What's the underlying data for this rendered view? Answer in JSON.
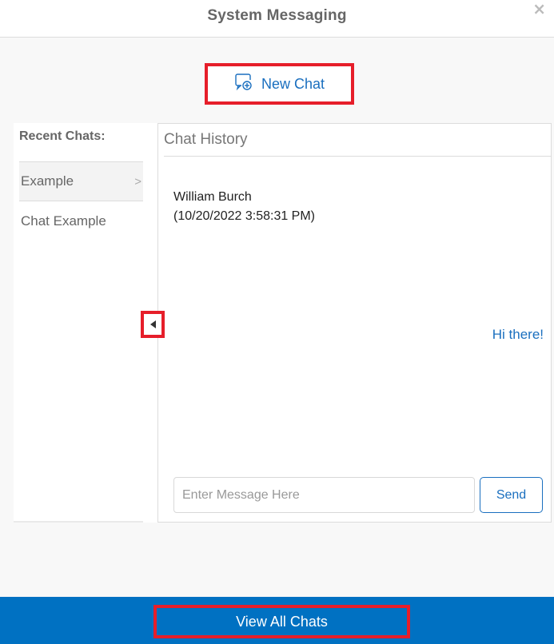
{
  "header": {
    "title": "System Messaging",
    "close_icon": "×"
  },
  "new_chat": {
    "label": "New Chat",
    "icon": "chat-add-icon"
  },
  "recent_chats": {
    "title": "Recent Chats:",
    "items": [
      {
        "label": "Example",
        "active": true,
        "chevron": ">"
      },
      {
        "label": "Chat Example",
        "active": false,
        "chevron": ""
      }
    ]
  },
  "collapse_toggle": {
    "icon": "caret-left-icon"
  },
  "chat_history": {
    "title": "Chat History",
    "messages": [
      {
        "sender": "William Burch",
        "timestamp": "(10/20/2022 3:58:31 PM)",
        "direction": "incoming"
      },
      {
        "text": "Hi there!",
        "direction": "outgoing"
      }
    ],
    "input": {
      "value": "",
      "placeholder": "Enter Message Here"
    },
    "send_label": "Send"
  },
  "footer": {
    "view_all_label": "View All Chats"
  },
  "colors": {
    "accent": "#1a6fbf",
    "footer_bg": "#0071c2",
    "highlight_border": "#e61e2a"
  }
}
